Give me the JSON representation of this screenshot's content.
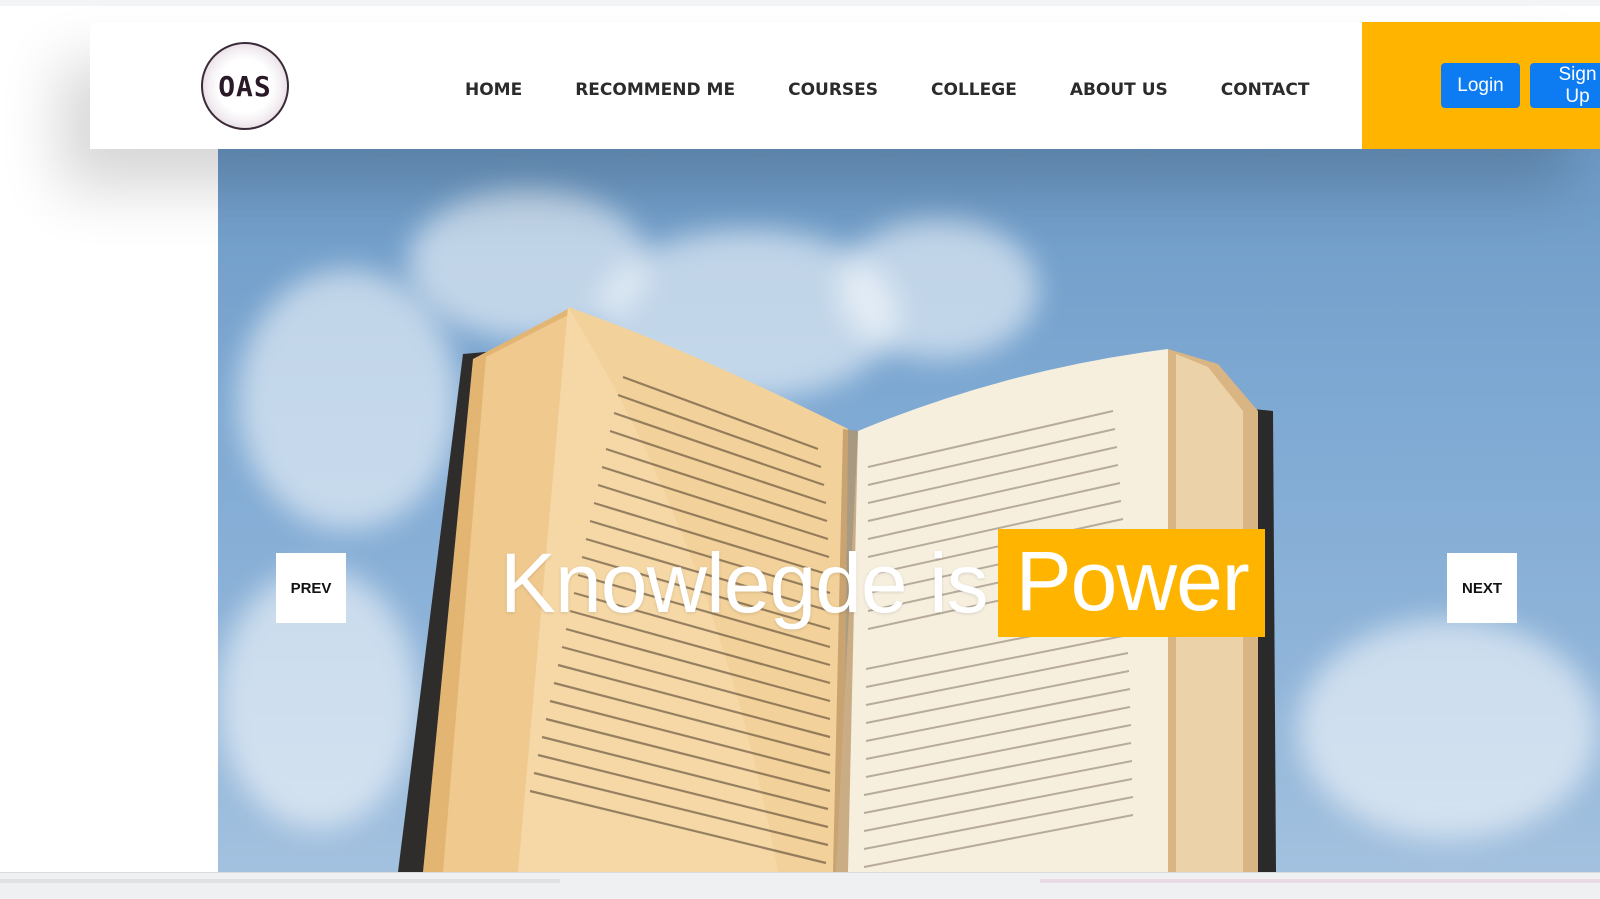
{
  "brand": {
    "logo_text": "OAS"
  },
  "nav": {
    "items": [
      "HOME",
      "RECOMMEND ME",
      "COURSES",
      "COLLEGE",
      "ABOUT US",
      "CONTACT"
    ]
  },
  "auth": {
    "login_label": "Login",
    "signup_label": "Sign Up"
  },
  "hero": {
    "headline_plain": "Knowlegde is",
    "headline_highlight": "Power",
    "prev_label": "PREV",
    "next_label": "NEXT"
  },
  "colors": {
    "accent_yellow": "#ffb400",
    "button_blue": "#0d7cf2",
    "nav_text": "#2b2b2b",
    "sky_blue": "#7ea9d3"
  },
  "icons": {
    "slide_image": "open-book-image"
  }
}
